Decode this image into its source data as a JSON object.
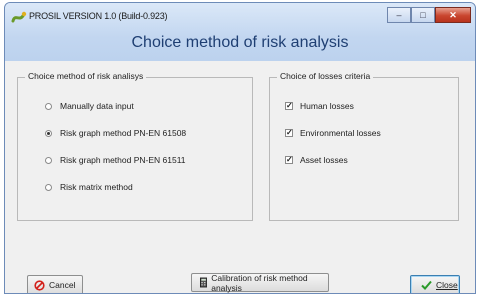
{
  "window": {
    "title": "PROSIL VERSION 1.0 (Build-0.923)",
    "heading": "Choice method of risk analysis"
  },
  "method_group": {
    "legend": "Choice method of risk analisys",
    "options": [
      {
        "label": "Manually data input",
        "selected": false
      },
      {
        "label": "Risk graph method PN-EN 61508",
        "selected": true
      },
      {
        "label": "Risk graph method PN-EN 61511",
        "selected": false
      },
      {
        "label": "Risk matrix method",
        "selected": false
      }
    ]
  },
  "losses_group": {
    "legend": "Choice of losses criteria",
    "options": [
      {
        "label": "Human losses",
        "checked": true
      },
      {
        "label": "Environmental losses",
        "checked": true
      },
      {
        "label": "Asset losses",
        "checked": true
      }
    ]
  },
  "buttons": {
    "cancel": "Cancel",
    "calibration": "Calibration of risk method analysis",
    "close": "Close"
  },
  "icons": {
    "app": "snake-logo-icon",
    "cancel": "no-entry-icon",
    "calibration": "calculator-icon",
    "close": "checkmark-icon"
  }
}
